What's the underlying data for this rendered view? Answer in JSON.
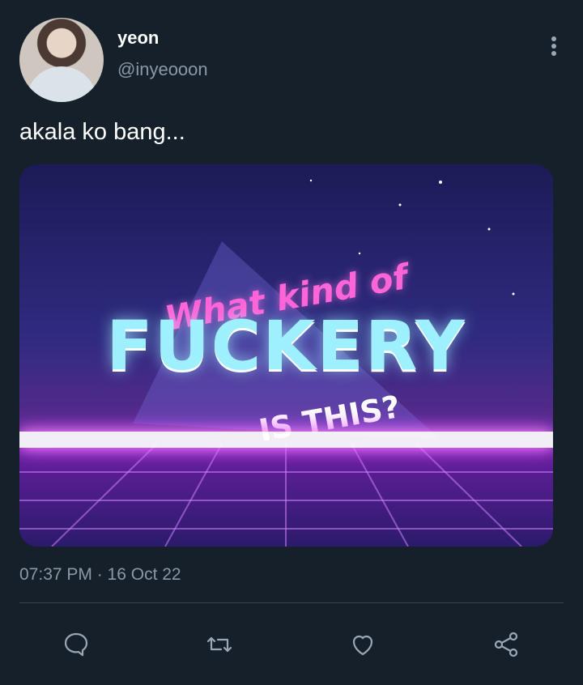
{
  "tweet": {
    "author": {
      "display_name": "yeon",
      "handle": "@inyeooon"
    },
    "text": "akala ko bang...",
    "media": {
      "alt_title": "What kind of",
      "main_text": "FUCKERY",
      "subtext": "IS THIS?"
    },
    "timestamp": "07:37 PM · 16 Oct 22"
  },
  "icons": {
    "more": "more-vertical-icon",
    "reply": "reply-icon",
    "retweet": "retweet-icon",
    "like": "heart-icon",
    "share": "share-icon"
  },
  "colors": {
    "background": "#15202b",
    "secondary_text": "#8b98a5",
    "icon": "#9aa8b6"
  }
}
